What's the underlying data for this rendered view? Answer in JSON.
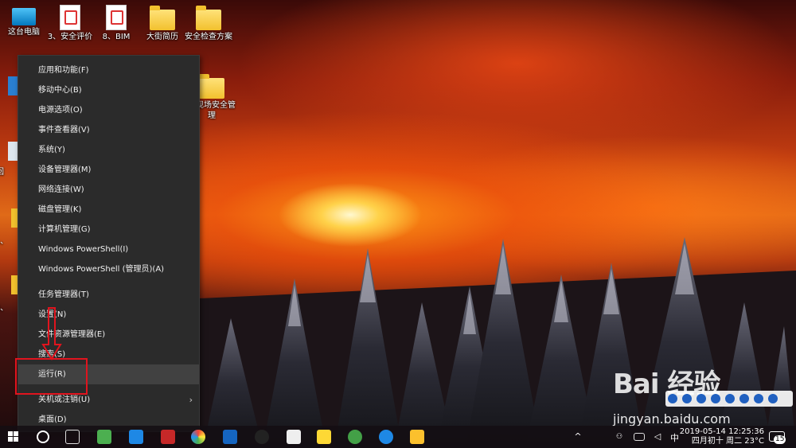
{
  "desktop": {
    "icons": [
      {
        "label": "这台电脑",
        "type": "pc"
      },
      {
        "label": "3、安全评价",
        "type": "doc"
      },
      {
        "label": "8、BIM",
        "type": "doc"
      },
      {
        "label": "大街简历",
        "type": "folder"
      },
      {
        "label": "安全检查方案",
        "type": "folder"
      },
      {
        "label": "工现场安全管理",
        "type": "folder"
      }
    ],
    "partial_labels": [
      "回",
      "1、",
      "2、"
    ]
  },
  "context_menu": {
    "items": [
      {
        "label": "应用和功能(F)"
      },
      {
        "label": "移动中心(B)"
      },
      {
        "label": "电源选项(O)"
      },
      {
        "label": "事件查看器(V)"
      },
      {
        "label": "系统(Y)"
      },
      {
        "label": "设备管理器(M)"
      },
      {
        "label": "网络连接(W)"
      },
      {
        "label": "磁盘管理(K)"
      },
      {
        "label": "计算机管理(G)"
      },
      {
        "label": "Windows PowerShell(I)"
      },
      {
        "label": "Windows PowerShell (管理员)(A)"
      },
      {
        "label": "任务管理器(T)"
      },
      {
        "label": "设置(N)"
      },
      {
        "label": "文件资源管理器(E)"
      },
      {
        "label": "搜索(S)"
      },
      {
        "label": "运行(R)"
      },
      {
        "label": "关机或注销(U)"
      },
      {
        "label": "桌面(D)"
      }
    ],
    "highlighted": "运行(R)",
    "annotation_color": "#e0141e"
  },
  "taskbar": {
    "time": "2019-05-14 12:25:36",
    "lunar_date": "四月初十 周二 23°C",
    "ime": "中",
    "notification_count": "15"
  },
  "watermark": {
    "logo": "Bai 经验",
    "url": "jingyan.baidu.com"
  }
}
